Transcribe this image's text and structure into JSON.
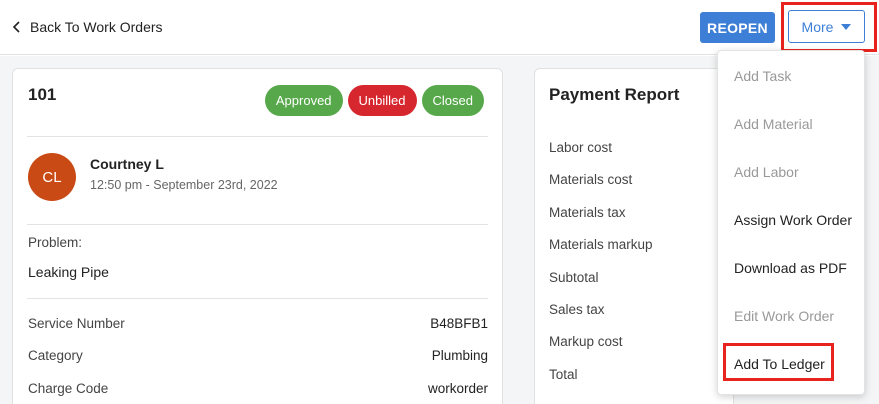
{
  "header": {
    "back_label": "Back To Work Orders",
    "reopen_label": "REOPEN",
    "more_label": "More"
  },
  "work_order": {
    "id": "101",
    "badges": [
      "Approved",
      "Unbilled",
      "Closed"
    ],
    "author": {
      "initials": "CL",
      "name": "Courtney L",
      "timestamp": "12:50 pm - September 23rd, 2022"
    },
    "problem_label": "Problem:",
    "problem_value": "Leaking Pipe",
    "details": [
      {
        "label": "Service Number",
        "value": "B48BFB1"
      },
      {
        "label": "Category",
        "value": "Plumbing"
      },
      {
        "label": "Charge Code",
        "value": "workorder"
      }
    ]
  },
  "payment_report": {
    "title": "Payment Report",
    "rows": [
      "Labor cost",
      "Materials cost",
      "Materials tax",
      "Materials markup",
      "Subtotal",
      "Sales tax",
      "Markup cost",
      "Total"
    ]
  },
  "more_menu": {
    "items": [
      {
        "label": "Add Task",
        "enabled": false
      },
      {
        "label": "Add Material",
        "enabled": false
      },
      {
        "label": "Add Labor",
        "enabled": false
      },
      {
        "label": "Assign Work Order",
        "enabled": true
      },
      {
        "label": "Download as PDF",
        "enabled": true
      },
      {
        "label": "Edit Work Order",
        "enabled": false
      },
      {
        "label": "Add To Ledger",
        "enabled": true
      }
    ]
  },
  "colors": {
    "primary": "#3d7fd6",
    "approved": "#56a84a",
    "unbilled": "#d6272e",
    "closed": "#56a84a",
    "avatar": "#c94a14",
    "highlight": "#e8231e"
  }
}
